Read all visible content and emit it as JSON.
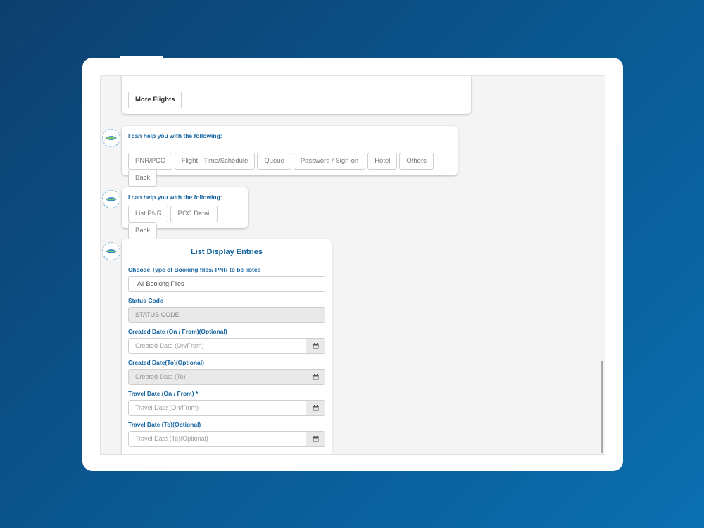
{
  "first_bubble": {
    "more_flights_label": "More Flights"
  },
  "menu_one": {
    "prompt": "I can help you with the following:",
    "options": [
      "PNR/PCC",
      "Flight - Time/Schedule",
      "Queue",
      "Password / Sign-on",
      "Hotel",
      "Others",
      "Back"
    ]
  },
  "menu_two": {
    "prompt": "I can help you with the following:",
    "options": [
      "List PNR",
      "PCC Detail",
      "Back"
    ]
  },
  "form": {
    "title": "List Display Entries",
    "booking_label": "Choose Type of Booking files/ PNR to be listed",
    "booking_value": "All Booking Files",
    "status_label": "Status Code",
    "status_placeholder": "STATUS CODE",
    "created_from_label": "Created Date (On / From)(Optional)",
    "created_from_placeholder": "Created Date (On/From)",
    "created_to_label": "Created Date(To)(Optional)",
    "created_to_placeholder": "Created Date (To)",
    "travel_from_label": "Travel Date (On / From) *",
    "travel_from_placeholder": "Travel Date (On/From)",
    "travel_to_label": "Travel Date (To)(Optional)",
    "travel_to_placeholder": "Travel Date (To)(Optional)"
  },
  "icons": {
    "bot": "bot-avatar-icon",
    "calendar": "calendar-icon"
  },
  "colors": {
    "accent": "#1464a0",
    "bg_gradient_start": "#0d3f6e",
    "bg_gradient_end": "#0b6fb0"
  }
}
